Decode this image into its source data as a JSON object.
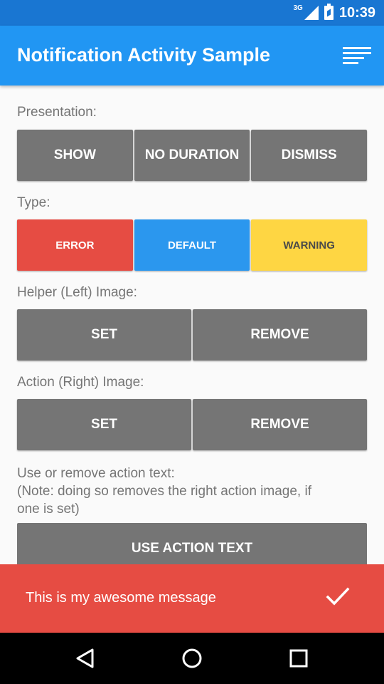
{
  "status_bar": {
    "network": "3G",
    "time": "10:39"
  },
  "app_bar": {
    "title": "Notification Activity Sample",
    "menu_icon": "sort-lines-icon"
  },
  "presentation": {
    "label": "Presentation:",
    "buttons": [
      "SHOW",
      "NO DURATION",
      "DISMISS"
    ]
  },
  "type": {
    "label": "Type:",
    "buttons": [
      "ERROR",
      "DEFAULT",
      "WARNING"
    ],
    "colors": {
      "error": "#e64c43",
      "default": "#2b97ee",
      "warning": "#fed643"
    }
  },
  "helper_image": {
    "label": "Helper (Left) Image:",
    "buttons": [
      "SET",
      "REMOVE"
    ]
  },
  "action_image": {
    "label": "Action (Right) Image:",
    "buttons": [
      "SET",
      "REMOVE"
    ]
  },
  "action_text": {
    "lines": [
      "Use or remove action text:",
      "(Note: doing so removes the right action image, if",
      "one is set)"
    ],
    "button": "USE ACTION TEXT"
  },
  "snackbar": {
    "message": "This is my awesome message",
    "action_icon": "checkmark-icon",
    "color": "#e64c43"
  },
  "nav_bar": {
    "icons": [
      "back-icon",
      "home-icon",
      "recents-icon"
    ]
  }
}
